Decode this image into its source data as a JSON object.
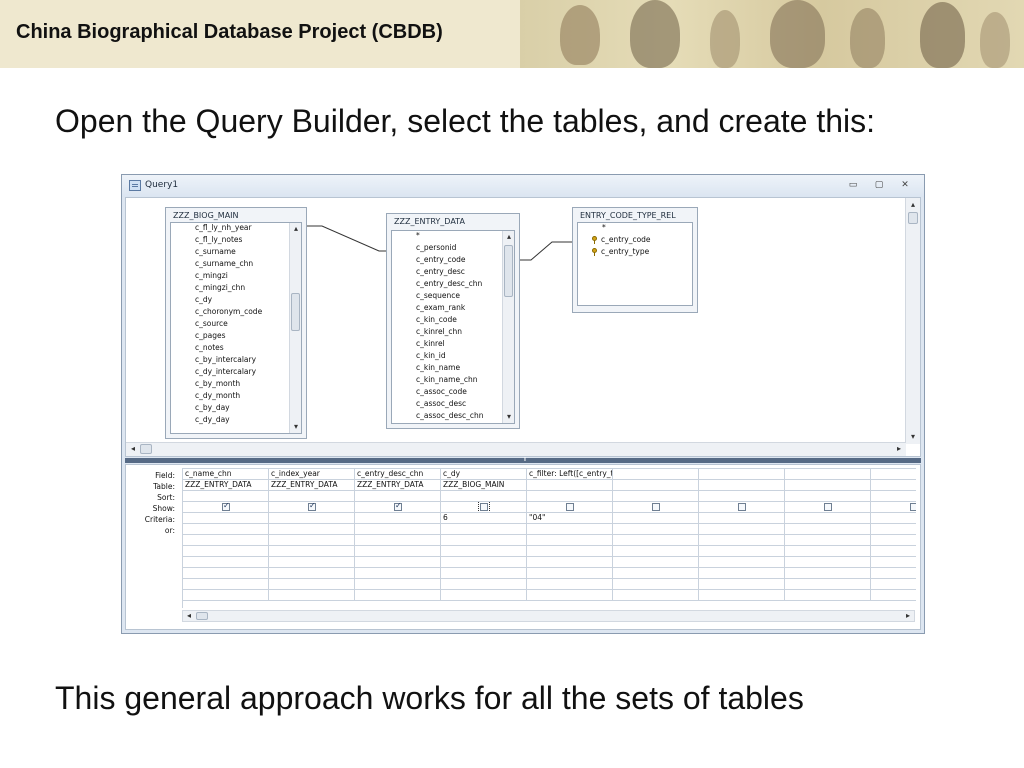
{
  "header": {
    "title": "China Biographical Database Project (CBDB)"
  },
  "slide": {
    "heading": "Open the Query Builder, select the tables, and create this:",
    "footer": "This general approach works for all the sets of tables"
  },
  "window": {
    "title": "Query1",
    "min_glyph": "▭",
    "max_glyph": "▢",
    "close_glyph": "✕"
  },
  "tables": [
    {
      "name": "ZZZ_BIOG_MAIN",
      "fields": [
        "c_fl_ly_nh_year",
        "c_fl_ly_notes",
        "c_surname",
        "c_surname_chn",
        "c_mingzi",
        "c_mingzi_chn",
        "c_dy",
        "c_choronym_code",
        "c_source",
        "c_pages",
        "c_notes",
        "c_by_intercalary",
        "c_dy_intercalary",
        "c_by_month",
        "c_dy_month",
        "c_by_day",
        "c_dy_day"
      ]
    },
    {
      "name": "ZZZ_ENTRY_DATA",
      "fields": [
        "*",
        "c_personid",
        "c_entry_code",
        "c_entry_desc",
        "c_entry_desc_chn",
        "c_sequence",
        "c_exam_rank",
        "c_kin_code",
        "c_kinrel_chn",
        "c_kinrel",
        "c_kin_id",
        "c_kin_name",
        "c_kin_name_chn",
        "c_assoc_code",
        "c_assoc_desc",
        "c_assoc_desc_chn"
      ]
    },
    {
      "name": "ENTRY_CODE_TYPE_REL",
      "fields": [
        "*",
        "c_entry_code",
        "c_entry_type"
      ]
    }
  ],
  "grid": {
    "row_labels": [
      "Field:",
      "Table:",
      "Sort:",
      "Show:",
      "Criteria:",
      "or:"
    ],
    "columns": [
      {
        "field": "c_name_chn",
        "table": "ZZZ_ENTRY_DATA",
        "show": true,
        "criteria": ""
      },
      {
        "field": "c_index_year",
        "table": "ZZZ_ENTRY_DATA",
        "show": true,
        "criteria": ""
      },
      {
        "field": "c_entry_desc_chn",
        "table": "ZZZ_ENTRY_DATA",
        "show": true,
        "criteria": ""
      },
      {
        "field": "c_dy",
        "table": "ZZZ_BIOG_MAIN",
        "show": false,
        "criteria": "6"
      },
      {
        "field": "c_filter: Left([c_entry_t",
        "table": "",
        "show": false,
        "criteria": "\"04\""
      },
      {
        "field": "",
        "table": "",
        "show": false,
        "criteria": ""
      },
      {
        "field": "",
        "table": "",
        "show": false,
        "criteria": ""
      },
      {
        "field": "",
        "table": "",
        "show": false,
        "criteria": ""
      },
      {
        "field": "",
        "table": "",
        "show": false,
        "criteria": ""
      }
    ]
  },
  "scroll": {
    "left_arrow": "◂",
    "right_arrow": "▸",
    "up_arrow": "▴",
    "down_arrow": "▾",
    "grip": "⦀"
  }
}
